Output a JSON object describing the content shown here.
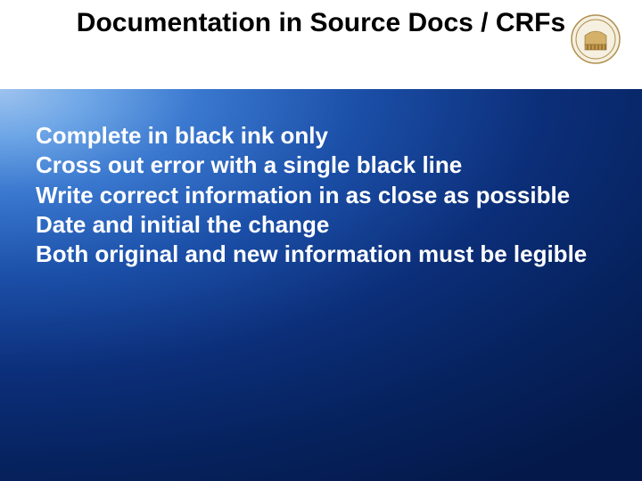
{
  "slide": {
    "title": "Documentation in Source Docs / CRFs",
    "logo_name": "seal-icon",
    "bullets": [
      "Complete in black ink only",
      "Cross out error with a single black line",
      "Write correct information in as close as possible",
      "Date and initial the change",
      "Both original and new information must be legible"
    ]
  }
}
